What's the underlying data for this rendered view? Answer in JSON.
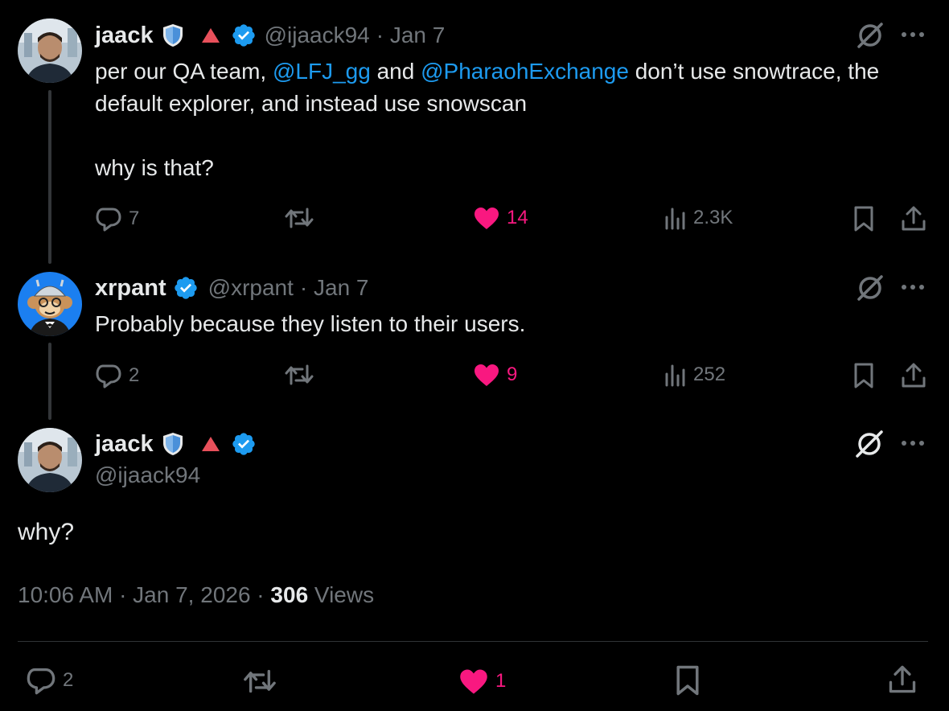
{
  "colors": {
    "accent": "#1d9bf0",
    "like": "#f91880",
    "muted": "#71767b",
    "text": "#e7e9ea"
  },
  "tweets": [
    {
      "name": "jaack",
      "handle": "@ijaack94",
      "date": "· Jan 7",
      "text_before_1": "per our QA team, ",
      "mention_1": "@LFJ_gg",
      "text_between": " and ",
      "mention_2": "@PharaohExchange",
      "text_after": " don’t use snowtrace, the default explorer, and instead use snowscan",
      "text_question": "why is that?",
      "replies": "7",
      "likes": "14",
      "views": "2.3K",
      "icons": [
        "shield-icon",
        "red-triangle-icon",
        "verified-badge-icon",
        "grok-icon",
        "more-icon"
      ]
    },
    {
      "name": "xrpant",
      "handle": "@xrpant",
      "date": "· Jan 7",
      "text": "Probably because they listen to their users.",
      "replies": "2",
      "likes": "9",
      "views": "252"
    }
  ],
  "main": {
    "name": "jaack",
    "handle": "@ijaack94",
    "text": "why?",
    "timestamp": "10:06 AM · Jan 7, 2026 · ",
    "views_count": "306",
    "views_label": " Views",
    "replies": "2",
    "likes": "1"
  }
}
